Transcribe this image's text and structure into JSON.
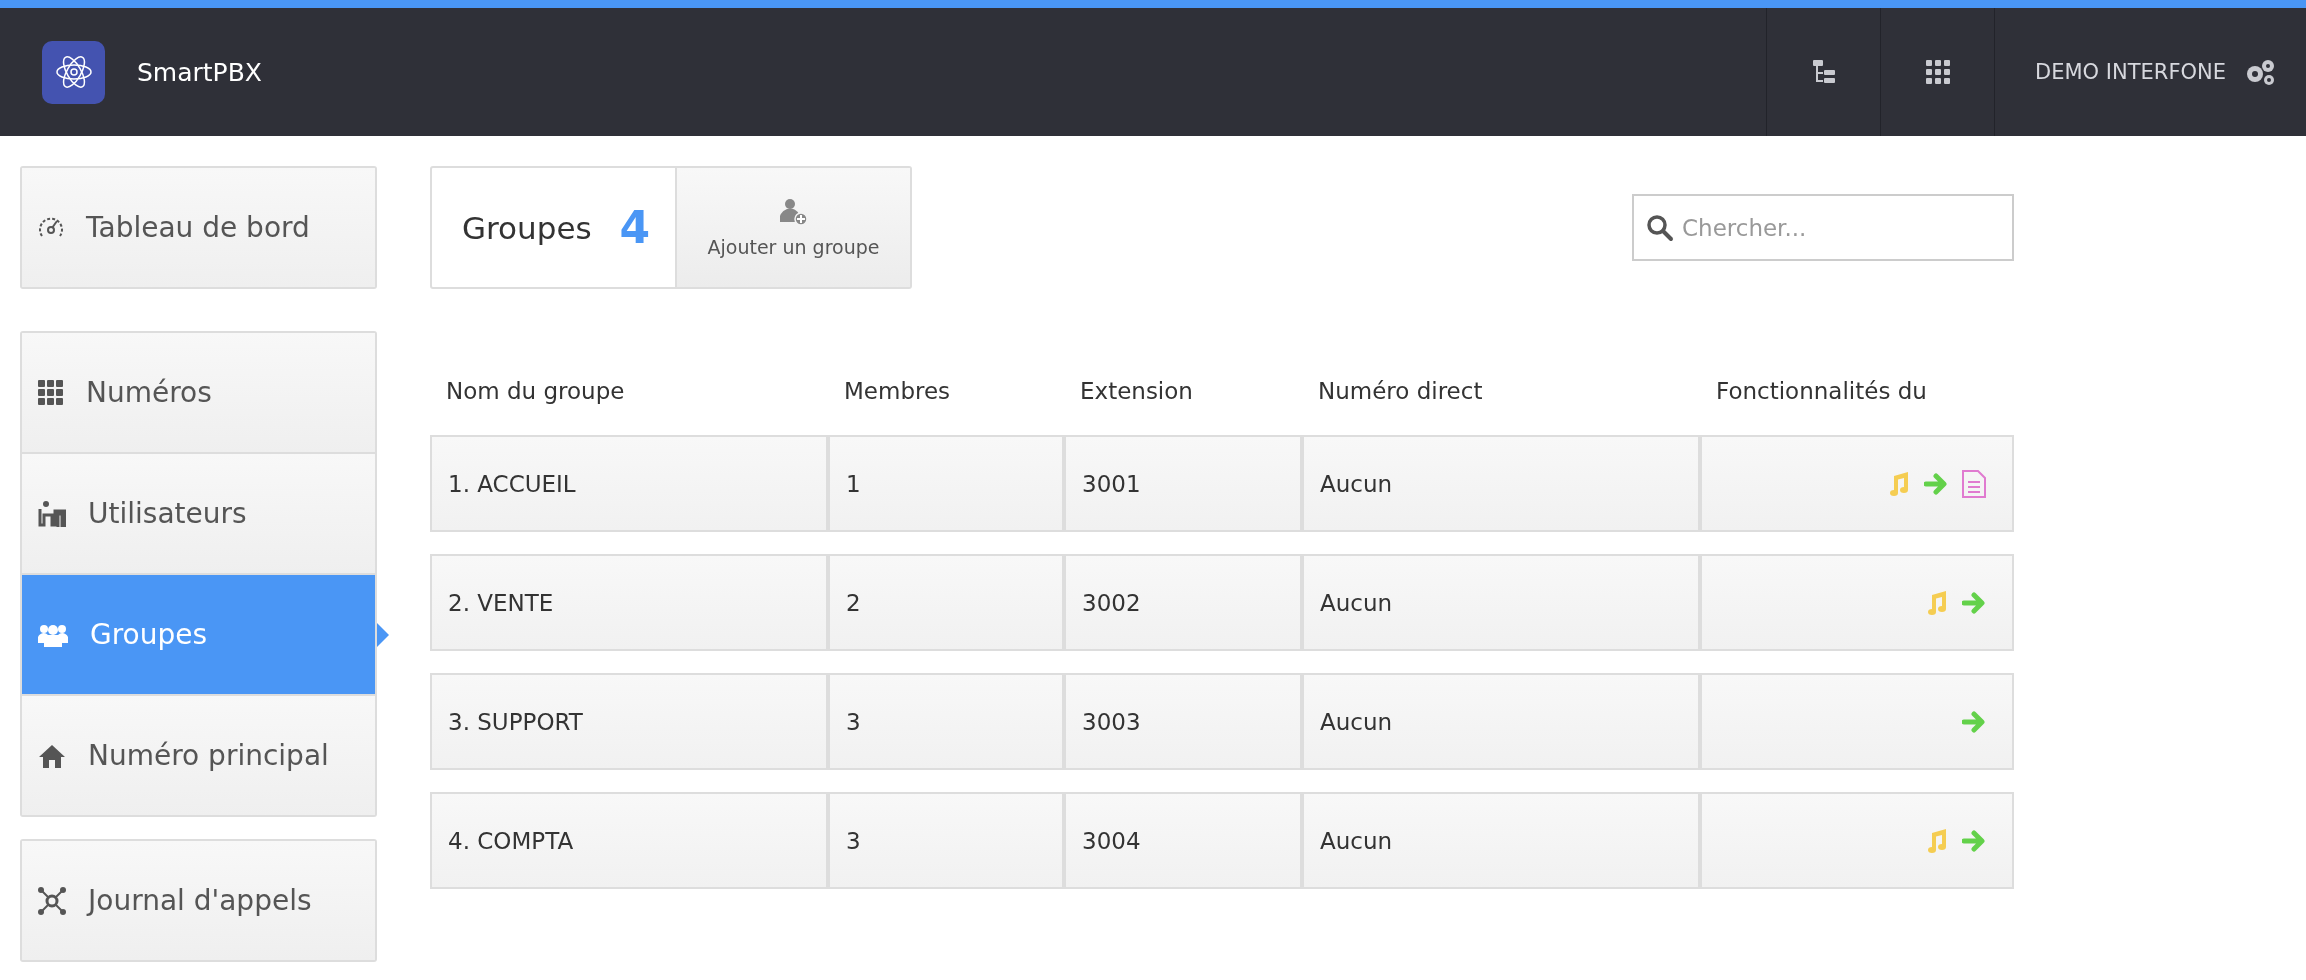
{
  "header": {
    "title": "SmartPBX",
    "account": "DEMO INTERFONE"
  },
  "sidebar": {
    "groups": [
      {
        "items": [
          {
            "label": "Tableau de bord",
            "selected": false
          }
        ]
      },
      {
        "items": [
          {
            "label": "Numéros",
            "selected": false
          },
          {
            "label": "Utilisateurs",
            "selected": false
          },
          {
            "label": "Groupes",
            "selected": true
          },
          {
            "label": "Numéro principal",
            "selected": false
          }
        ]
      },
      {
        "items": [
          {
            "label": "Journal d'appels",
            "selected": false
          }
        ]
      }
    ]
  },
  "toolbar": {
    "title": "Groupes",
    "count": "4",
    "add_button": "Ajouter un groupe",
    "search": {
      "placeholder": "Chercher..."
    }
  },
  "table": {
    "columns": [
      "Nom du groupe",
      "Membres",
      "Extension",
      "Numéro direct",
      "Fonctionnalités du"
    ],
    "rows": [
      {
        "name": "1. ACCUEIL",
        "members": "1",
        "extension": "3001",
        "direct": "Aucun",
        "features": [
          {
            "kind": "music"
          },
          {
            "kind": "forward"
          },
          {
            "kind": "document"
          }
        ]
      },
      {
        "name": "2. VENTE",
        "members": "2",
        "extension": "3002",
        "direct": "Aucun",
        "features": [
          {
            "kind": "music"
          },
          {
            "kind": "forward"
          }
        ]
      },
      {
        "name": "3. SUPPORT",
        "members": "3",
        "extension": "3003",
        "direct": "Aucun",
        "features": [
          {
            "kind": "forward"
          }
        ]
      },
      {
        "name": "4. COMPTA",
        "members": "3",
        "extension": "3004",
        "direct": "Aucun",
        "features": [
          {
            "kind": "music"
          },
          {
            "kind": "forward"
          }
        ]
      }
    ]
  }
}
